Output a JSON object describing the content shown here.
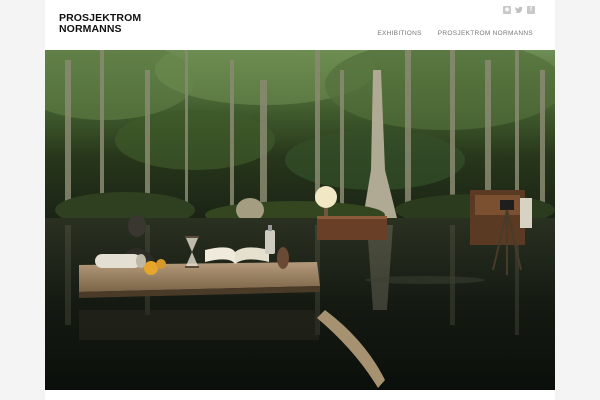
{
  "site": {
    "logo_line1": "PROSJEKTROM",
    "logo_line2": "NORMANNS"
  },
  "social": [
    {
      "icon": "rss-icon",
      "glyph": "◉"
    },
    {
      "icon": "twitter-icon",
      "glyph": "🐦"
    },
    {
      "icon": "facebook-icon",
      "glyph": "f"
    }
  ],
  "nav": {
    "items": [
      {
        "label": "EXHIBITIONS"
      },
      {
        "label": "PROSJEKTROM NORMANNS"
      }
    ]
  },
  "hero": {
    "alt": "Still life on a wooden raft in a flooded cypress swamp with books, bust, lamp and camera"
  },
  "colors": {
    "page_bg": "#ffffff",
    "side_band": "#f4f4f4",
    "nav_text": "#777777",
    "logo_text": "#111111",
    "social_icon": "#c8c8c8"
  }
}
